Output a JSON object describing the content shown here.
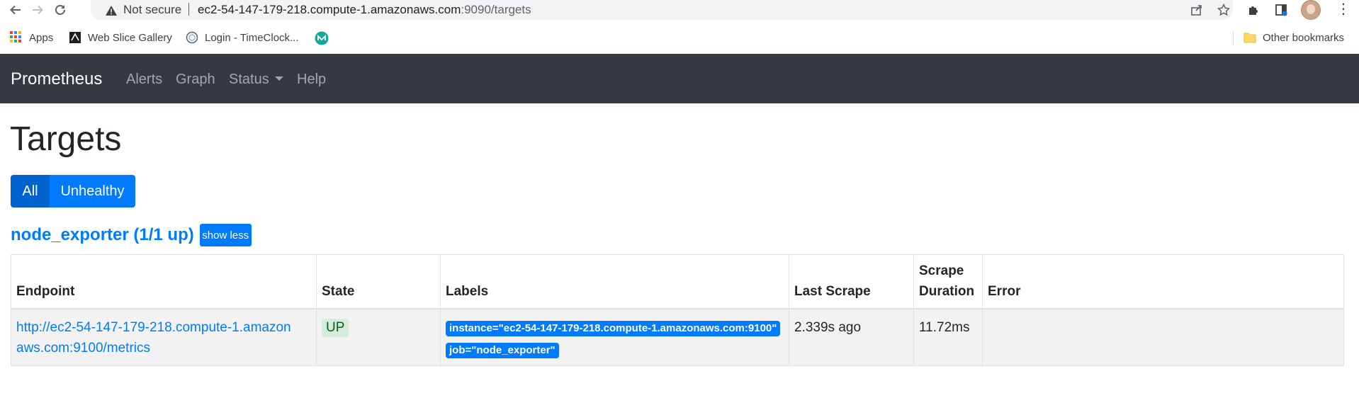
{
  "browser": {
    "security_text": "Not secure",
    "url_host": "ec2-54-147-179-218.compute-1.amazonaws.com",
    "url_rest": ":9090/targets"
  },
  "bookmarks": {
    "items": [
      {
        "label": "Apps",
        "icon": "apps-grid-icon"
      },
      {
        "label": "Web Slice Gallery",
        "icon": "web-slice-icon"
      },
      {
        "label": "Login - TimeClock...",
        "icon": "globe-icon"
      },
      {
        "label": "",
        "icon": "teal-logo-icon"
      }
    ],
    "other": "Other bookmarks"
  },
  "navbar": {
    "brand": "Prometheus",
    "links": [
      "Alerts",
      "Graph",
      "Status",
      "Help"
    ],
    "bg_color": "#343a40"
  },
  "page": {
    "title": "Targets",
    "filters": {
      "all": "All",
      "unhealthy": "Unhealthy"
    },
    "job": {
      "title": "node_exporter (1/1 up)",
      "toggle": "show less"
    }
  },
  "table": {
    "headers": {
      "endpoint": "Endpoint",
      "state": "State",
      "labels": "Labels",
      "last_scrape": "Last Scrape",
      "scrape_duration_1": "Scrape",
      "scrape_duration_2": "Duration",
      "error": "Error"
    },
    "rows": [
      {
        "endpoint_1": "http://ec2-54-147-179-218.compute-1.amazon",
        "endpoint_2": "aws.com:9100/metrics",
        "state": "UP",
        "label_instance": "instance=\"ec2-54-147-179-218.compute-1.amazonaws.com:9100\"",
        "label_job": "job=\"node_exporter\"",
        "last_scrape": "2.339s ago",
        "scrape_duration": "11.72ms",
        "error": ""
      }
    ]
  },
  "colors": {
    "primary": "#007bff",
    "primary_active": "#0062cc",
    "up_bg": "#d4edda",
    "up_text": "#155724"
  }
}
